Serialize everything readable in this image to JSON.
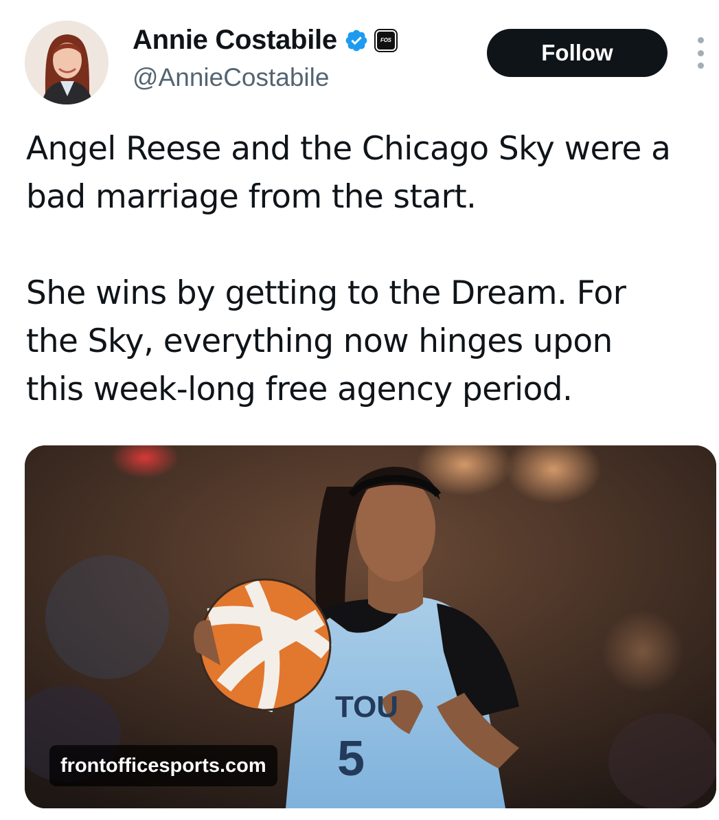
{
  "author": {
    "display_name": "Annie Costabile",
    "handle": "@AnnieCostabile",
    "verified": true,
    "verified_color": "#1d9bf0",
    "affiliation_badge": "FOS"
  },
  "actions": {
    "follow_label": "Follow",
    "more_icon": "more-vertical-icon"
  },
  "tweet": {
    "paragraphs": [
      "Angel Reese and the Chicago Sky were a bad marriage from the start.",
      "She wins by getting to the Dream. For the Sky, everything now hinges upon this week-long free agency period."
    ],
    "lines": [
      "Angel Reese and the Chicago Sky were a",
      "bad marriage from the start.",
      "She wins by getting to the Dream. For",
      "the Sky, everything now hinges upon",
      "this week-long free agency period."
    ]
  },
  "media": {
    "link_domain": "frontofficesports.com",
    "jersey_text": "TOU",
    "jersey_number": "5"
  },
  "colors": {
    "text": "#0f1419",
    "secondary_text": "#536471",
    "button_bg": "#0f1419"
  }
}
